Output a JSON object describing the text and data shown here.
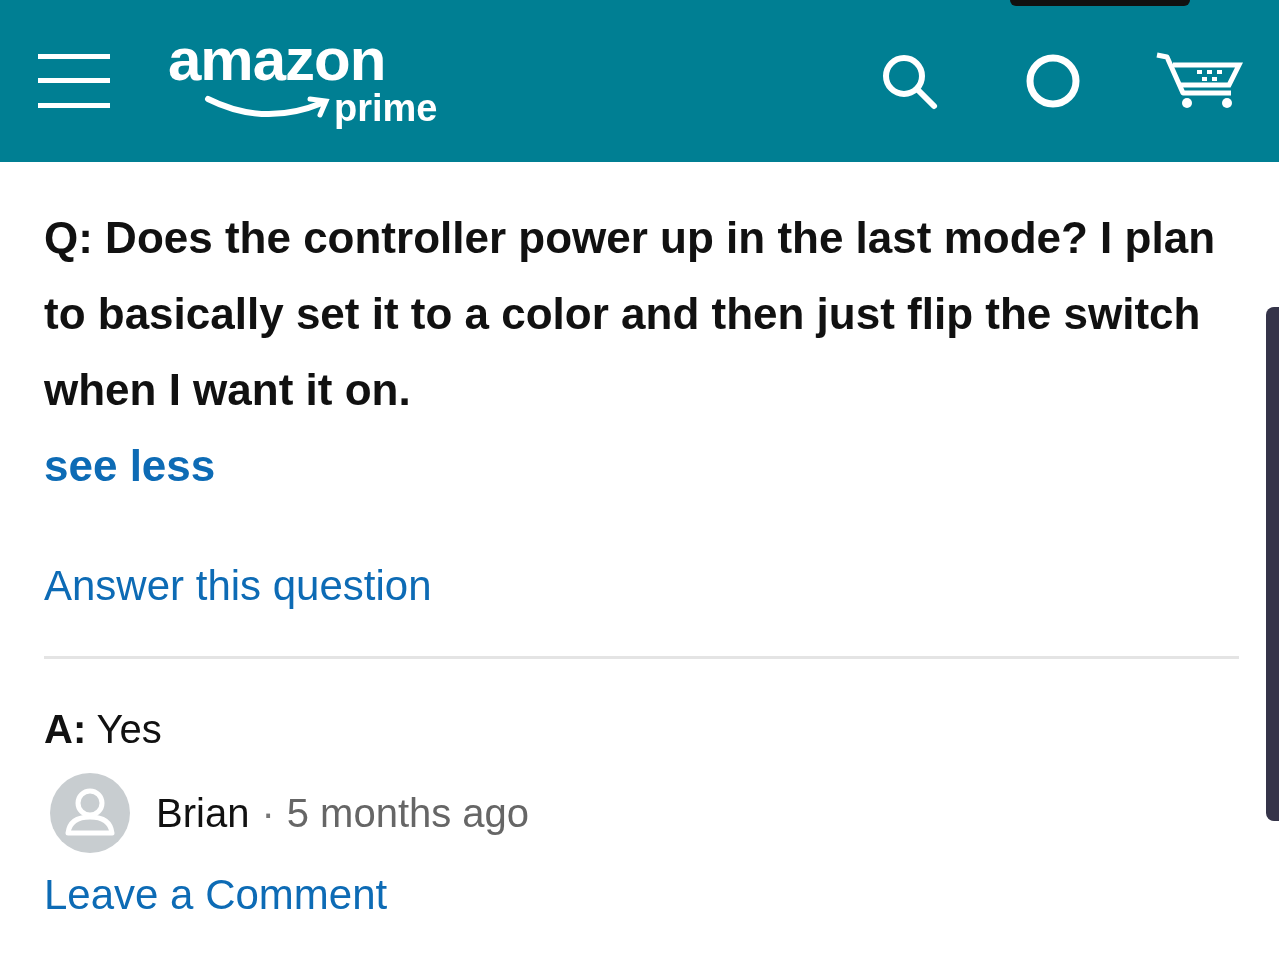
{
  "header": {
    "logo": {
      "wordmark": "amazon",
      "sub": "prime"
    }
  },
  "question": {
    "prefix": "Q:",
    "text": "Does the controller power up in the last mode? I plan to basically set it to a color and then just flip the switch when I want it on.",
    "toggle": "see less"
  },
  "answer_link": "Answer this question",
  "answer": {
    "prefix": "A:",
    "text": "Yes",
    "author": "Brian",
    "separator": "·",
    "time": "5 months ago"
  },
  "comment_link": "Leave a Comment"
}
